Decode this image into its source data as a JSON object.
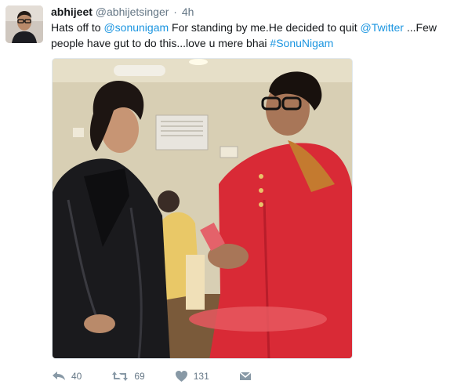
{
  "tweet": {
    "fullname": "abhijeet",
    "username": "@abhijetsinger",
    "separator": "·",
    "time": "4h",
    "text": {
      "t1": "Hats off to ",
      "mention1": "@sonunigam",
      "t2": " For standing by me.He decided to quit ",
      "mention2": "@Twitter",
      "t3": " ...Few people have gut to do this...love u mere bhai ",
      "hashtag": "#SonuNigam"
    },
    "media": {
      "icon": "photo-image"
    }
  },
  "actions": {
    "reply": {
      "icon": "reply-icon",
      "count": "40"
    },
    "retweet": {
      "icon": "retweet-icon",
      "count": "69"
    },
    "like": {
      "icon": "heart-icon",
      "count": "131"
    },
    "message": {
      "icon": "envelope-icon"
    }
  },
  "colors": {
    "link": "#1b95e0",
    "action": "#8899a6",
    "text": "#14171a",
    "secondary": "#657786"
  }
}
